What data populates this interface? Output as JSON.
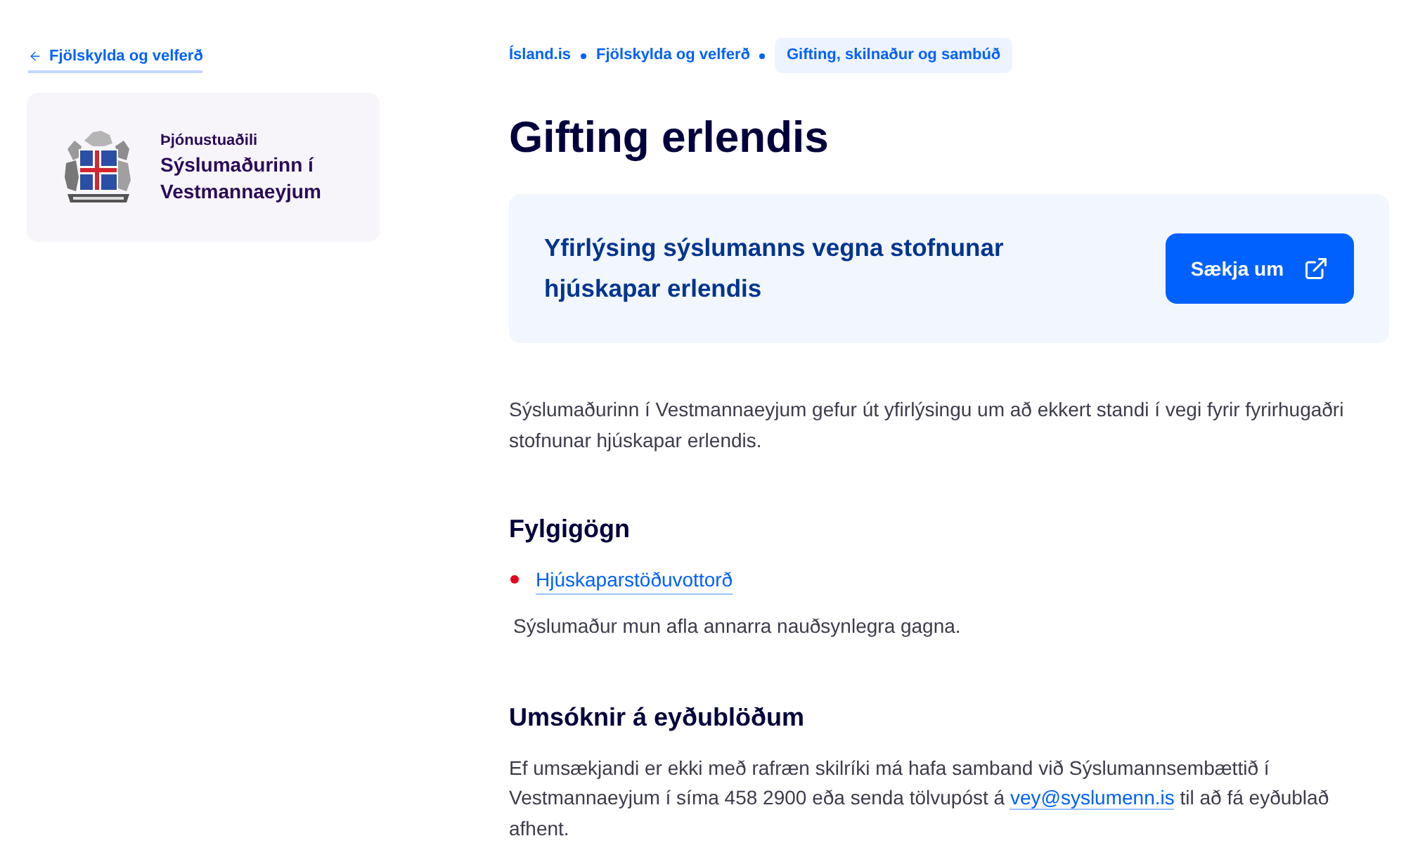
{
  "back_link": {
    "label": "Fjölskylda og velferð"
  },
  "provider_card": {
    "caption": "Þjónustuaðili",
    "name": "Sýslumaðurinn í Vestmannaeyjum"
  },
  "breadcrumbs": [
    {
      "label": "Ísland.is",
      "current": false
    },
    {
      "label": "Fjölskylda og velferð",
      "current": false
    },
    {
      "label": "Gifting, skilnaður og sambúð",
      "current": true
    }
  ],
  "title": "Gifting erlendis",
  "action_box": {
    "title": "Yfirlýsing sýslumanns vegna stofnunar hjúskapar erlendis",
    "button": "Sækja um"
  },
  "sections": [
    {
      "kind": "paragraph",
      "parts": [
        {
          "text": "Sýslumaðurinn í Vestmannaeyjum gefur út yfirlýsingu um að ekkert standi í vegi fyrir fyrirhugaðri stofnunar hjúskapar erlendis.",
          "link": false
        }
      ]
    },
    {
      "kind": "heading",
      "text": "Fylgigögn"
    },
    {
      "kind": "list",
      "items": [
        {
          "text": "Hjúskaparstöðuvottorð",
          "link": true
        }
      ]
    },
    {
      "kind": "paragraph",
      "parts": [
        {
          "text": "Sýslumaður mun afla annarra nauðsynlegra gagna.",
          "link": false
        }
      ]
    },
    {
      "kind": "heading",
      "text": "Umsóknir á eyðublöðum"
    },
    {
      "kind": "paragraph",
      "parts": [
        {
          "text": "Ef umsækjandi er ekki með rafræn skilríki má hafa samband við Sýslumannsembættið í Vestmannaeyjum í síma 458 2900 eða senda tölvupóst á ",
          "link": false
        },
        {
          "text": "vey@syslumenn.is",
          "link": true
        },
        {
          "text": " til að fá eyðublað afhent.",
          "link": false
        }
      ]
    }
  ]
}
